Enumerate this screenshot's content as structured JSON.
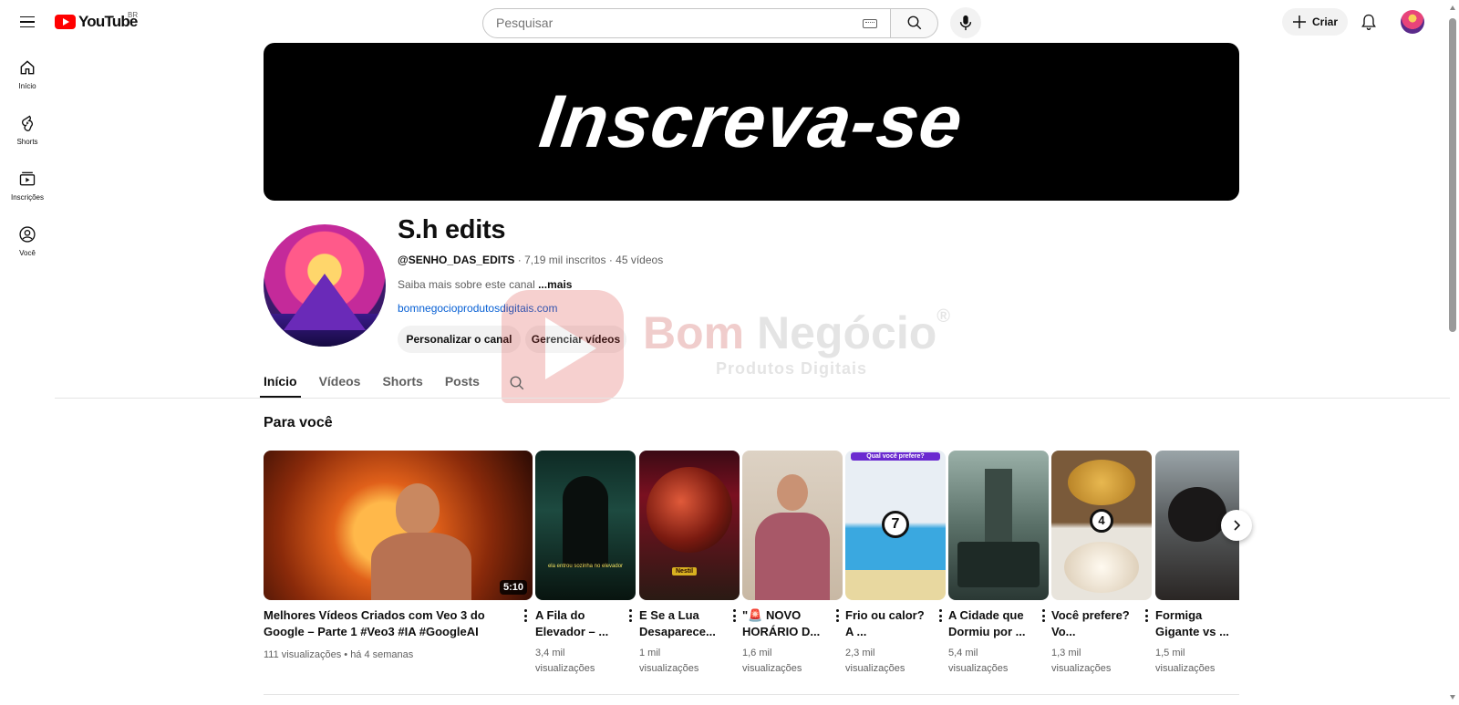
{
  "header": {
    "logo_text": "YouTube",
    "region": "BR",
    "search_placeholder": "Pesquisar",
    "create_label": "Criar"
  },
  "sidebar": {
    "items": [
      {
        "label": "Início",
        "icon": "home-icon"
      },
      {
        "label": "Shorts",
        "icon": "shorts-icon"
      },
      {
        "label": "Inscrições",
        "icon": "subscriptions-icon"
      },
      {
        "label": "Você",
        "icon": "user-icon"
      }
    ]
  },
  "banner": {
    "text": "Inscreva-se"
  },
  "channel": {
    "name": "S.h edits",
    "handle": "@SENHO_DAS_EDITS",
    "subscribers": "7,19 mil inscritos",
    "videos": "45 vídeos",
    "about": "Saiba mais sobre este canal",
    "about_more": "...mais",
    "link": "bomnegocioprodutosdigitais.com",
    "customize_label": "Personalizar o canal",
    "manage_label": "Gerenciar vídeos"
  },
  "tabs": [
    "Início",
    "Vídeos",
    "Shorts",
    "Posts"
  ],
  "watermark": {
    "title_a": "Bom",
    "title_b": "Negócio",
    "registered": "®",
    "subtitle": "Produtos Digitais"
  },
  "section": {
    "title": "Para você",
    "featured": {
      "title": "Melhores Vídeos Criados com Veo 3 do Google – Parte 1 #Veo3 #IA #GoogleAI",
      "views": "111 visualizações",
      "age": "há 4 semanas",
      "duration": "5:10"
    },
    "shorts": [
      {
        "title": "A Fila do Elevador – ...",
        "views_num": "3,4 mil",
        "views_word": "visualizações",
        "caption": "ela entrou sozinha no elevador"
      },
      {
        "title": "E Se a Lua Desaparece...",
        "views_num": "1 mil",
        "views_word": "visualizações",
        "caption": "Nestil"
      },
      {
        "title": "\"🚨 NOVO HORÁRIO D...",
        "views_num": "1,6 mil",
        "views_word": "visualizações",
        "caption": ""
      },
      {
        "title": "Frio ou calor? A ...",
        "views_num": "2,3 mil",
        "views_word": "visualizações",
        "caption": "Qual você prefere?",
        "badge": "7"
      },
      {
        "title": "A Cidade que Dormiu por ...",
        "views_num": "5,4 mil",
        "views_word": "visualizações",
        "caption": ""
      },
      {
        "title": "Você prefere? Vo...",
        "views_num": "1,3 mil",
        "views_word": "visualizações",
        "caption": "",
        "badge": "4"
      },
      {
        "title": "Formiga Gigante vs ...",
        "views_num": "1,5 mil",
        "views_word": "visualizações",
        "caption": ""
      }
    ]
  }
}
